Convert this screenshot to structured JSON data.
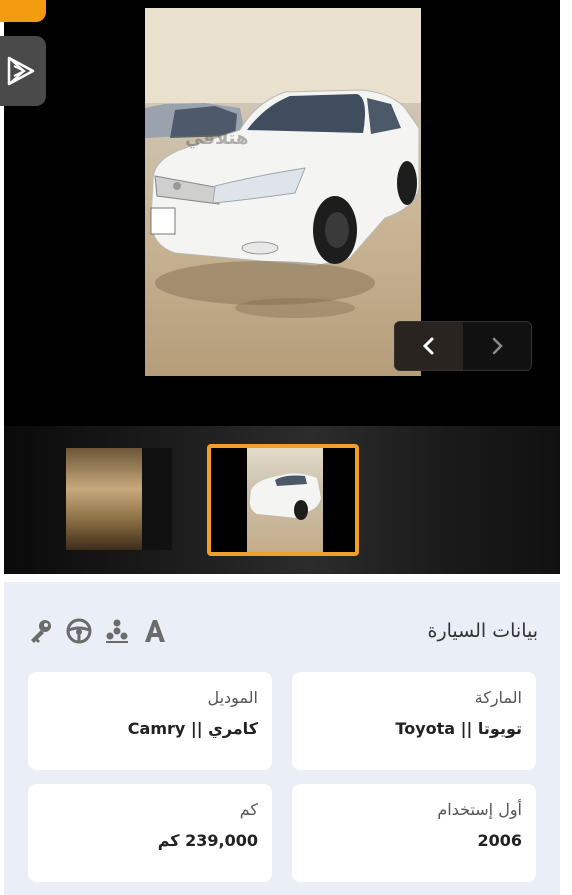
{
  "gallery": {
    "watermark": "هتلاقي",
    "nav": {
      "prev_icon": "chevron-left-icon",
      "next_icon": "chevron-right-icon"
    },
    "active_thumb_color": "#f0a02a"
  },
  "info": {
    "title": "بيانات السيارة",
    "icons": [
      "letter-a-icon",
      "engine-icon",
      "steering-wheel-icon",
      "key-icon"
    ],
    "cards": {
      "brand": {
        "label": "الماركة",
        "value": "تويوتا || Toyota"
      },
      "model": {
        "label": "الموديل",
        "value": "كامري || Camry"
      },
      "year": {
        "label": "أول إستخدام",
        "value": "2006"
      },
      "km": {
        "label": "كم",
        "value": "239,000 كم"
      }
    }
  }
}
